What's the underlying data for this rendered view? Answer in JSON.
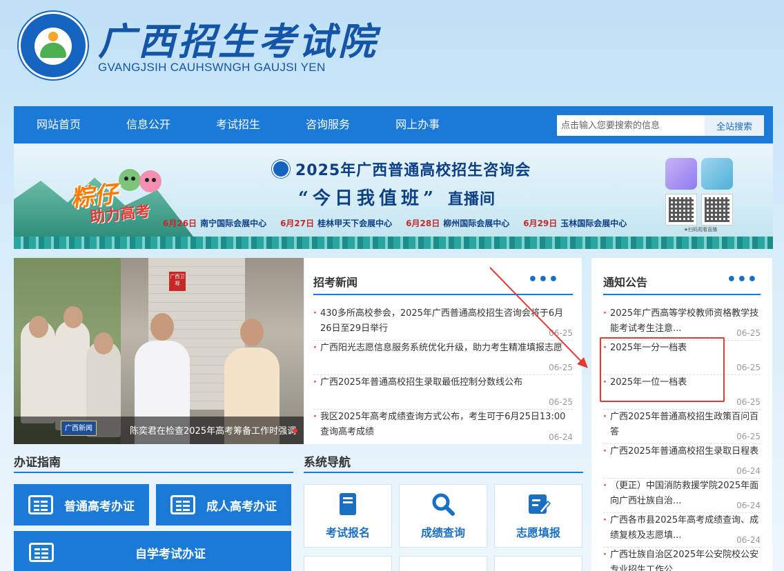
{
  "header": {
    "title": "广西招生考试院",
    "subtitle": "GVANGJSIH CAUHSWNGH GAUJSI YEN",
    "emblem_text": "GVANGJSIH CAUHSWNGH GAUJSI YEN"
  },
  "nav": {
    "items": [
      "网站首页",
      "信息公开",
      "考试招生",
      "咨询服务",
      "网上办事"
    ],
    "search_placeholder": "点击输入您要搜索的信息",
    "search_button": "全站搜索"
  },
  "banner": {
    "slogan_top": "粽仔",
    "slogan_bottom": "助力高考",
    "title": "2025年广西普通高校招生咨询会",
    "subtitle_quote": "“今日我值班”",
    "subtitle_live": "直播间",
    "schedule": [
      {
        "date": "6月26日",
        "place": "南宁国际会展中心"
      },
      {
        "date": "6月27日",
        "place": "桂林甲天下会展中心"
      },
      {
        "date": "6月28日",
        "place": "柳州国际会展中心"
      },
      {
        "date": "6月29日",
        "place": "玉林国际会展中心"
      }
    ],
    "qr_caption": "★扫码观看直播"
  },
  "slideshow": {
    "caption": "陈奕君在检查2025年高考筹备工作时强调",
    "tag": "广西新闻",
    "tv_logo": "广西卫视"
  },
  "news": {
    "title": "招考新闻",
    "items": [
      {
        "text": "430多所高校参会，2025年广西普通高校招生咨询会将于6月26日至29日举行",
        "date": "06-25"
      },
      {
        "text": "广西阳光志愿信息服务系统优化升级，助力考生精准填报志愿",
        "date": "06-25"
      },
      {
        "text": "广西2025年普通高校招生录取最低控制分数线公布",
        "date": "06-25"
      },
      {
        "text": "我区2025年高考成绩查询方式公布，考生可于6月25日13:00查询高考成绩",
        "date": "06-24"
      }
    ]
  },
  "notice": {
    "title": "通知公告",
    "items": [
      {
        "text": "2025年广西高等学校教师资格教学技能考试考生注意...",
        "date": "06-25"
      },
      {
        "text": "2025年一分一档表",
        "date": "06-25"
      },
      {
        "text": "2025年一位一档表",
        "date": "06-25"
      },
      {
        "text": "广西2025年普通高校招生政策百问百答",
        "date": "06-25"
      },
      {
        "text": "广西2025年普通高校招生录取日程表",
        "date": "06-24"
      },
      {
        "text": "（更正）中国消防救援学院2025年面向广西壮族自治...",
        "date": "06-24"
      },
      {
        "text": "广西各市县2025年高考成绩查询、成绩复核及志愿填...",
        "date": "06-24"
      },
      {
        "text": "广西壮族自治区2025年公安院校公安专业招生工作公...",
        "date": ""
      }
    ]
  },
  "certificate": {
    "title": "办证指南",
    "buttons": [
      "普通高考办证",
      "成人高考办证",
      "自学考试办证"
    ]
  },
  "system_nav": {
    "title": "系统导航",
    "tiles": [
      "考试报名",
      "成绩查询",
      "志愿填报"
    ]
  },
  "colors": {
    "primary": "#1b7ad6",
    "title_blue": "#1555a8",
    "annotation_red": "#e53935"
  }
}
